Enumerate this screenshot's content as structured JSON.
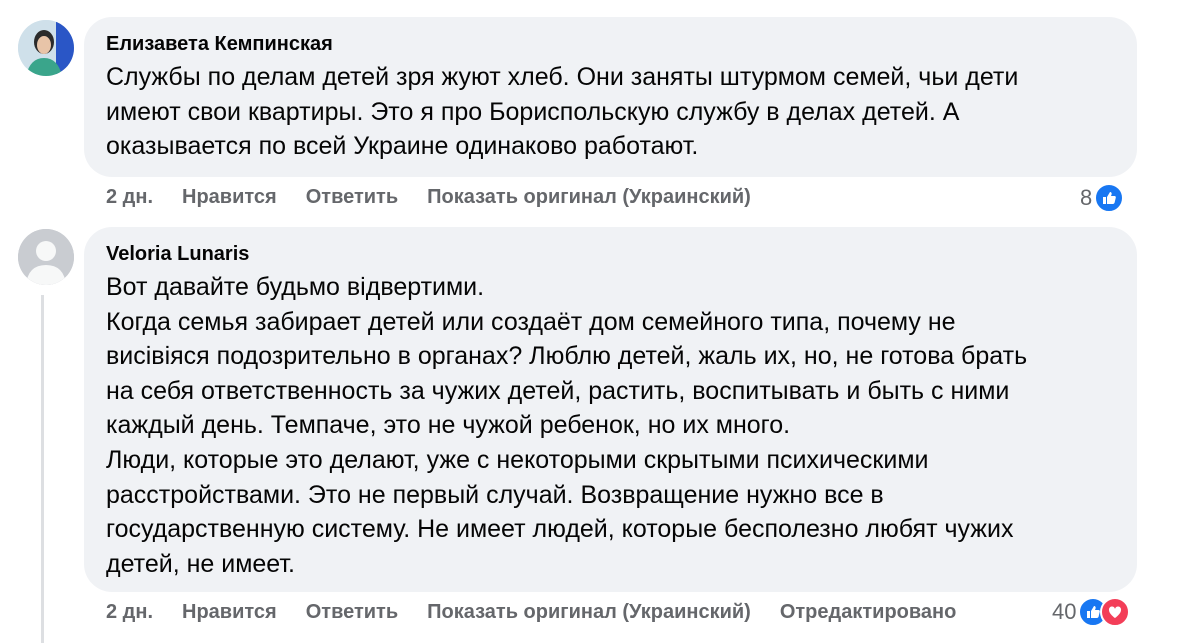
{
  "comments": [
    {
      "author": "Елизавета Кемпинская",
      "text": "Службы по делам детей зря жуют хлеб. Они заняты штурмом семей, чьи дети\nимеют свои квартиры. Это я про Бориспольскую службу в делах детей. А\nоказывается по всей Украине одинаково работают.",
      "time": "2 дн.",
      "like_label": "Нравится",
      "reply_label": "Ответить",
      "original_label": "Показать оригинал (Украинский)",
      "reaction_count": "8",
      "reactions": [
        "like-icon"
      ]
    },
    {
      "author": "Veloria Lunaris",
      "text": "Вот давайте будьмо відвертими.\nКогда семья забирает детей или создаёт дом семейного типа, почему не\nвисівіяся подозрительно в органах? Люблю детей, жаль их, но, не готова брать\nна себя ответственность за чужих детей, растить, воспитывать и быть с ними\nкаждый день. Темпаче, это не чужой ребенок, но их много.\nЛюди, которые это делают, уже с некоторыми скрытыми психическими\nрасстройствами. Это не первый случай. Возвращение нужно все в\nгосударственную систему. Не имеет людей, которые бесполезно любят чужих\nдетей, не имеет.",
      "time": "2 дн.",
      "like_label": "Нравится",
      "reply_label": "Ответить",
      "original_label": "Показать оригинал (Украинский)",
      "edited_label": "Отредактировано",
      "reaction_count": "40",
      "reactions": [
        "like-icon",
        "love-icon"
      ]
    }
  ],
  "colors": {
    "bubble": "#f0f2f5",
    "meta_text": "#65676b",
    "like_blue": "#1877f2",
    "love_red": "#f33e58"
  }
}
